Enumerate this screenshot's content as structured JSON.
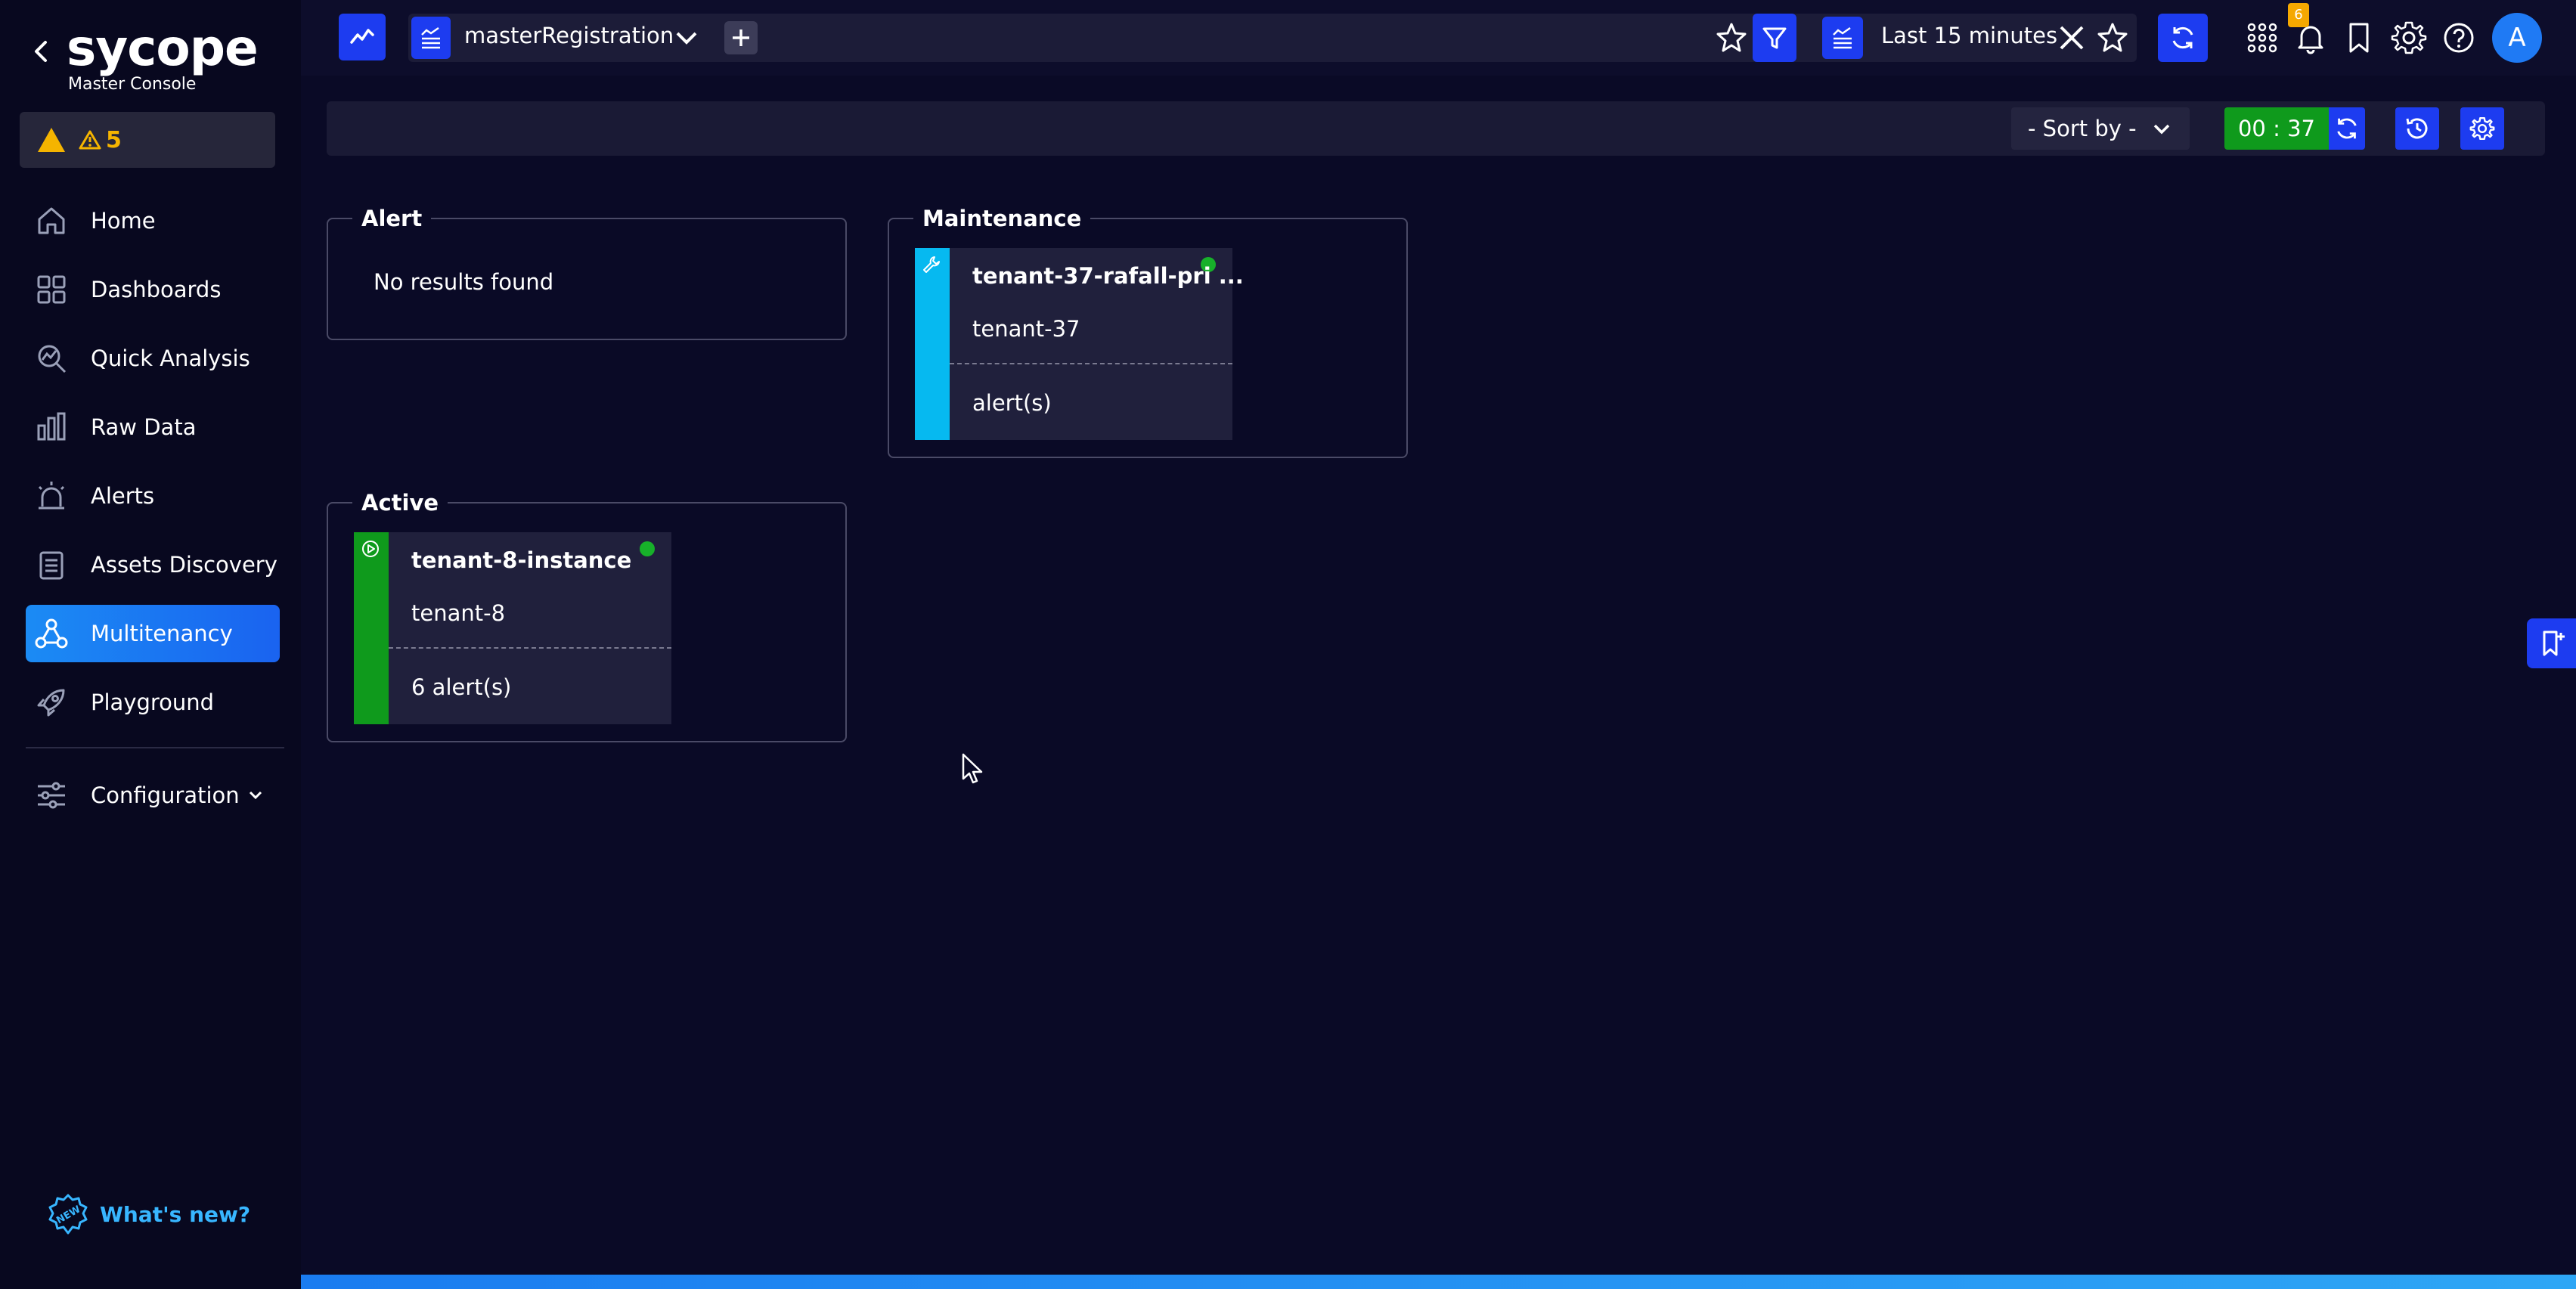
{
  "colors": {
    "background": "#0a0a26",
    "sidebar": "#08081f",
    "accent_blue": "#1d3cf0",
    "active_nav": "#1b8bf4",
    "maintenance_stripe": "#06b9f0",
    "active_stripe": "#0f9a1c",
    "status_dot": "#17b02a",
    "warning": "#f5b400"
  },
  "sidebar": {
    "logo_text": "sycope",
    "logo_subtitle": "Master Console",
    "warnings_count": "5",
    "items": [
      {
        "label": "Home",
        "icon": "home-icon"
      },
      {
        "label": "Dashboards",
        "icon": "dashboards-icon"
      },
      {
        "label": "Quick Analysis",
        "icon": "quick-analysis-icon"
      },
      {
        "label": "Raw Data",
        "icon": "raw-data-icon"
      },
      {
        "label": "Alerts",
        "icon": "alarm-icon"
      },
      {
        "label": "Assets Discovery",
        "icon": "clipboard-icon"
      },
      {
        "label": "Multitenancy",
        "icon": "multitenancy-icon",
        "active": true
      },
      {
        "label": "Playground",
        "icon": "rocket-icon"
      }
    ],
    "configuration_label": "Configuration",
    "whats_new_label": "What's new?"
  },
  "header": {
    "dashboard_name": "masterRegistration",
    "time_range": "Last 15 minutes",
    "notifications_badge": "6",
    "avatar_initial": "A"
  },
  "toolbar": {
    "sort_label": "- Sort by -",
    "timer": "00 : 37"
  },
  "groups": {
    "alert": {
      "title": "Alert",
      "empty_text": "No results found"
    },
    "maintenance": {
      "title": "Maintenance",
      "cards": [
        {
          "title": "tenant-37-rafall-pri ...",
          "tenant": "tenant-37",
          "alerts": "alert(s)"
        }
      ]
    },
    "active": {
      "title": "Active",
      "cards": [
        {
          "title": "tenant-8-instance",
          "tenant": "tenant-8",
          "alerts": "6 alert(s)"
        }
      ]
    }
  }
}
